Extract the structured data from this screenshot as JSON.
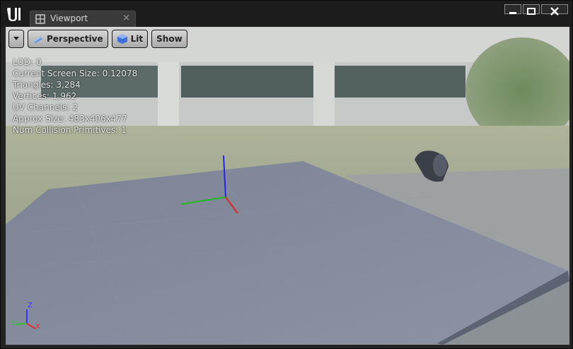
{
  "tab": {
    "label": "Viewport",
    "close_glyph": "×"
  },
  "window_controls": {
    "minimize": "minimize-icon",
    "maximize": "maximize-icon",
    "close": "close-icon"
  },
  "toolbar": {
    "perspective_label": "Perspective",
    "lit_label": "Lit",
    "show_label": "Show"
  },
  "stats": [
    {
      "label": "LOD:",
      "value": "0"
    },
    {
      "label": "Current Screen Size:",
      "value": "0.12078"
    },
    {
      "label": "Triangles:",
      "value": "3,284"
    },
    {
      "label": "Vertices:",
      "value": "1,962"
    },
    {
      "label": "UV Channels:",
      "value": "2"
    },
    {
      "label": "Approx Size:",
      "value": "483x406x477"
    },
    {
      "label": "Num Collision Primitives:",
      "value": "1"
    }
  ],
  "axis_gizmo": {
    "z": "Z",
    "y": "Y",
    "x": "X"
  },
  "colors": {
    "axis_x": "#e03030",
    "axis_y": "#30c030",
    "axis_z": "#3030ff",
    "plane": "#7f8898"
  }
}
